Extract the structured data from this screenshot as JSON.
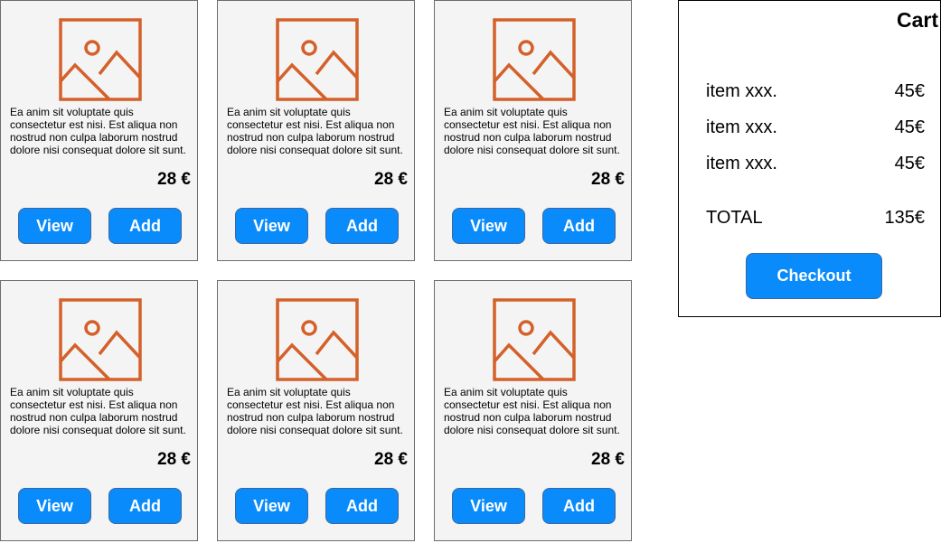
{
  "products": [
    {
      "description": "Ea anim sit voluptate quis consectetur est nisi. Est aliqua non nostrud non culpa laborum nostrud dolore nisi consequat dolore sit sunt.",
      "price": "28 €",
      "view_label": "View",
      "add_label": "Add"
    },
    {
      "description": "Ea anim sit voluptate quis consectetur est nisi. Est aliqua non nostrud non culpa laborum nostrud dolore nisi consequat dolore sit sunt.",
      "price": "28 €",
      "view_label": "View",
      "add_label": "Add"
    },
    {
      "description": "Ea anim sit voluptate quis consectetur est nisi. Est aliqua non nostrud non culpa laborum nostrud dolore nisi consequat dolore sit sunt.",
      "price": "28 €",
      "view_label": "View",
      "add_label": "Add"
    },
    {
      "description": "Ea anim sit voluptate quis consectetur est nisi. Est aliqua non nostrud non culpa laborum nostrud dolore nisi consequat dolore sit sunt.",
      "price": "28 €",
      "view_label": "View",
      "add_label": "Add"
    },
    {
      "description": "Ea anim sit voluptate quis consectetur est nisi. Est aliqua non nostrud non culpa laborum nostrud dolore nisi consequat dolore sit sunt.",
      "price": "28 €",
      "view_label": "View",
      "add_label": "Add"
    },
    {
      "description": "Ea anim sit voluptate quis consectetur est nisi. Est aliqua non nostrud non culpa laborum nostrud dolore nisi consequat dolore sit sunt.",
      "price": "28 €",
      "view_label": "View",
      "add_label": "Add"
    }
  ],
  "product_icon": "image-placeholder-icon",
  "cart": {
    "title": "Cart",
    "items": [
      {
        "name": "item xxx.",
        "price": "45€"
      },
      {
        "name": "item xxx.",
        "price": "45€"
      },
      {
        "name": "item xxx.",
        "price": "45€"
      }
    ],
    "total_label": "TOTAL",
    "total_value": "135€",
    "checkout_label": "Checkout"
  },
  "colors": {
    "button_bg": "#0a8bfb",
    "icon_orange": "#d4602a",
    "card_bg": "#f4f4f4"
  }
}
